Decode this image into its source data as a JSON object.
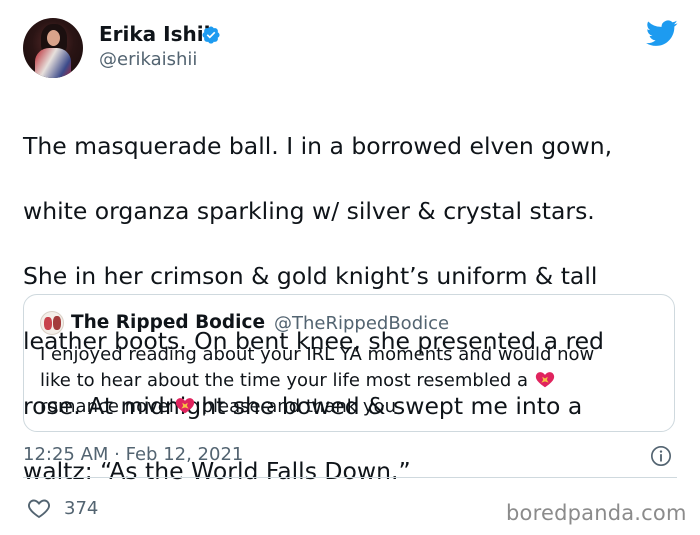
{
  "author": {
    "display_name": "Erika Ishii",
    "handle": "@erikaishii",
    "verified_icon": "verified-badge-icon",
    "avatar_icon": "avatar"
  },
  "platform_icon": "twitter-bird-icon",
  "tweet": {
    "text_lines": [
      "The masquerade ball. I in a borrowed elven gown,",
      "white organza sparkling w/ silver & crystal stars.",
      "She in her crimson & gold knight’s uniform & tall",
      "leather boots. On bent knee, she presented a red",
      "rose. At midnight she bowed & swept me into a",
      "waltz: “As the World Falls Down.”"
    ]
  },
  "quoted_tweet": {
    "display_name": "The Ripped Bodice",
    "handle": "@TheRippedBodice",
    "line1": "I enjoyed reading about your IRL YA  moments and would now",
    "line2": "like to hear about the time your life most resembled a ",
    "line3_prefix": "romance novel",
    "line3_suffix": " please and thank you",
    "emoji": "heart-with-ribbon-icon"
  },
  "timestamp": "12:25 AM · Feb 12, 2021",
  "info_icon": "info-icon",
  "likes": {
    "count": "374",
    "icon": "heart-outline-icon"
  },
  "watermark": "boredpanda.com",
  "colors": {
    "twitter_blue": "#1d9bf0",
    "text_primary": "#0f1419",
    "text_secondary": "#536471",
    "border": "#cfd9de"
  }
}
